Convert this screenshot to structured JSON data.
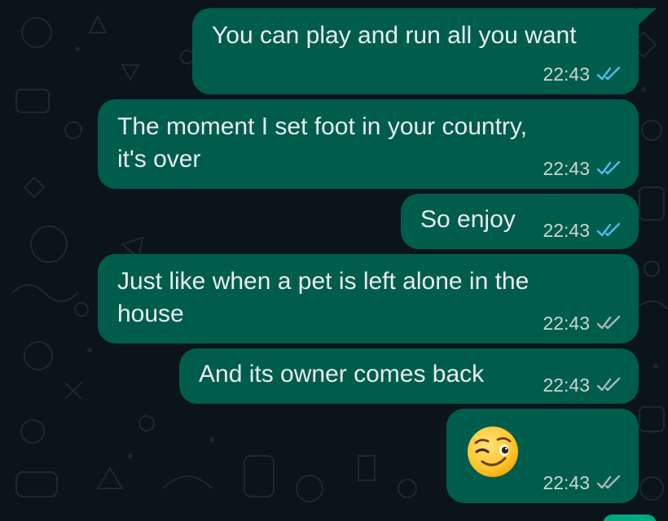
{
  "chat": {
    "messages": [
      {
        "text": "You can play and run all you want",
        "time": "22:43",
        "status": "read",
        "first_in_group": true
      },
      {
        "text_lines": [
          "The moment I set foot in your country,",
          "it's over"
        ],
        "time": "22:43",
        "status": "read"
      },
      {
        "text": "So enjoy",
        "time": "22:43",
        "status": "read"
      },
      {
        "text_lines": [
          "Just like when a pet is left alone in the",
          "house"
        ],
        "time": "22:43",
        "status": "delivered"
      },
      {
        "text": "And its owner comes back",
        "time": "22:43",
        "status": "delivered"
      },
      {
        "emoji": "winking-face",
        "time": "22:43",
        "status": "delivered"
      }
    ]
  },
  "colors": {
    "background": "#0b1418",
    "outgoing_bubble": "#005c4b",
    "read_ticks": "#53bdeb",
    "delivered_ticks": "#a9b8b5",
    "text": "#e9edef"
  }
}
